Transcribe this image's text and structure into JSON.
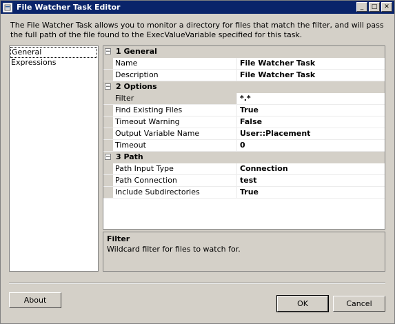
{
  "window": {
    "title": "File Watcher Task Editor"
  },
  "description": "The File Watcher Task allows you to monitor a directory for files that match the filter, and will pass the full path of the file found to the ExecValueVariable specified for this task.",
  "sidebar": {
    "items": [
      {
        "label": "General",
        "selected": true
      },
      {
        "label": "Expressions",
        "selected": false
      }
    ]
  },
  "properties": {
    "categories": [
      {
        "label": "1 General",
        "toggle": "⊟",
        "rows": [
          {
            "name": "Name",
            "value": "File Watcher Task"
          },
          {
            "name": "Description",
            "value": "File Watcher Task"
          }
        ]
      },
      {
        "label": "2 Options",
        "toggle": "⊟",
        "rows": [
          {
            "name": "Filter",
            "value": "*.*"
          },
          {
            "name": "Find Existing Files",
            "value": "True"
          },
          {
            "name": "Timeout Warning",
            "value": "False"
          },
          {
            "name": "Output Variable Name",
            "value": "User::Placement"
          },
          {
            "name": "Timeout",
            "value": "0"
          }
        ]
      },
      {
        "label": "3 Path",
        "toggle": "⊟",
        "rows": [
          {
            "name": "Path Input Type",
            "value": "Connection"
          },
          {
            "name": "Path Connection",
            "value": "test"
          },
          {
            "name": "Include Subdirectories",
            "value": "True"
          }
        ]
      }
    ]
  },
  "help": {
    "title": "Filter",
    "text": "Wildcard filter for files to watch for."
  },
  "buttons": {
    "about": "About",
    "ok": "OK",
    "cancel": "Cancel"
  },
  "title_buttons": {
    "minimize": "_",
    "maximize": "□",
    "close": "✕"
  }
}
